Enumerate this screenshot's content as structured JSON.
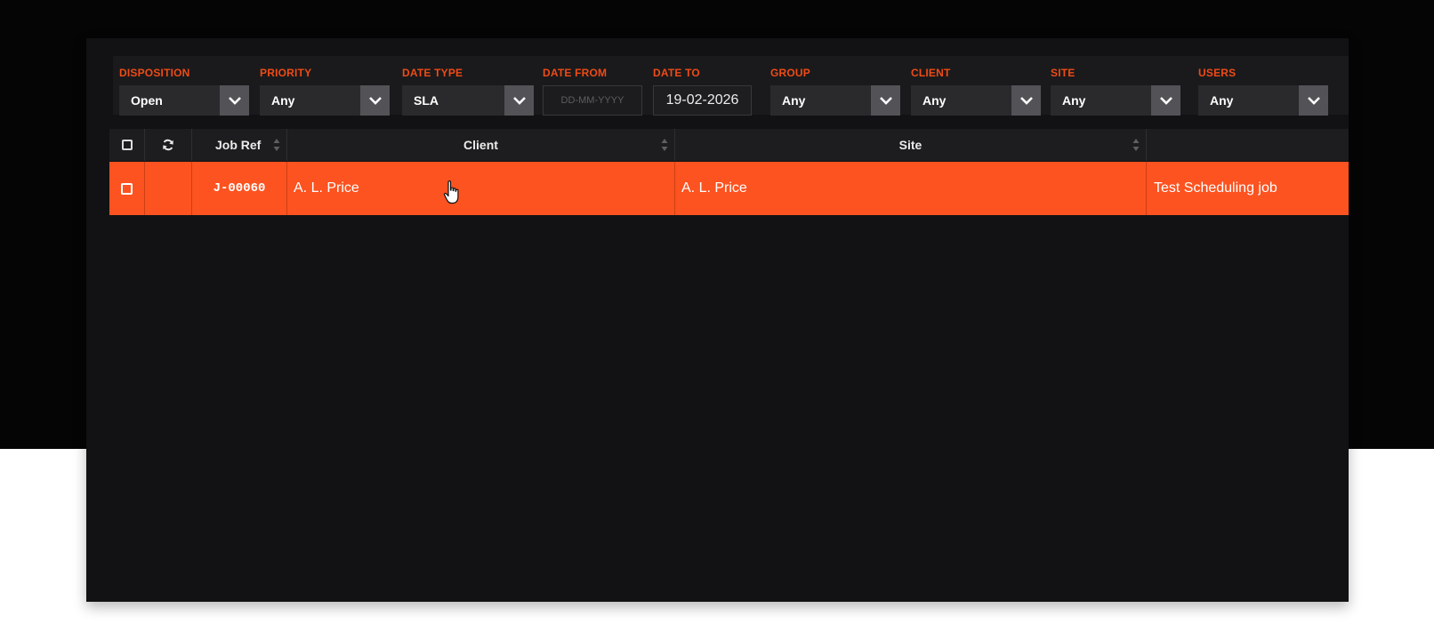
{
  "filters": [
    {
      "label": "DISPOSITION",
      "value": "Open"
    },
    {
      "label": "PRIORITY",
      "value": "Any"
    },
    {
      "label": "DATE TYPE",
      "value": "SLA"
    },
    {
      "label": "DATE FROM",
      "placeholder": "DD-MM-YYYY"
    },
    {
      "label": "DATE TO",
      "value": "19-02-2026"
    },
    {
      "label": "GROUP",
      "value": "Any"
    },
    {
      "label": "CLIENT",
      "value": "Any"
    },
    {
      "label": "SITE",
      "value": "Any"
    },
    {
      "label": "USERS",
      "value": "Any"
    }
  ],
  "columns": {
    "job_ref": "Job Ref",
    "client": "Client",
    "site": "Site",
    "description": ""
  },
  "rows": [
    {
      "job_ref": "J-00060",
      "client": "A. L. Price",
      "site": "A. L. Price",
      "description": "Test Scheduling job"
    }
  ],
  "icons": {
    "select_all": "checkbox-icon",
    "refresh": "refresh-icon",
    "sort": "sort-icon",
    "dropdown": "chevron-down-icon",
    "cursor": "hand-pointer-icon"
  },
  "colors": {
    "accent": "#ee4b16",
    "row_selected": "#fc5320",
    "panel_bg": "#121214"
  }
}
